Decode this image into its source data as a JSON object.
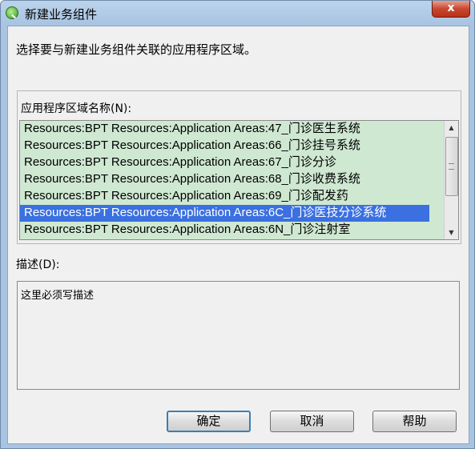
{
  "window": {
    "title": "新建业务组件",
    "close_label": "x"
  },
  "prompt": "选择要与新建业务组件关联的应用程序区域。",
  "list": {
    "label": "应用程序区域名称(N):",
    "items": [
      "Resources:BPT Resources:Application Areas:47_门诊医生系统",
      "Resources:BPT Resources:Application Areas:66_门诊挂号系统",
      "Resources:BPT Resources:Application Areas:67_门诊分诊",
      "Resources:BPT Resources:Application Areas:68_门诊收费系统",
      "Resources:BPT Resources:Application Areas:69_门诊配发药",
      "Resources:BPT Resources:Application Areas:6C_门诊医技分诊系统",
      "Resources:BPT Resources:Application Areas:6N_门诊注射室"
    ],
    "selected_index": 5
  },
  "description": {
    "label": "描述(D):",
    "value": "这里必须写描述"
  },
  "buttons": {
    "ok": "确定",
    "cancel": "取消",
    "help": "帮助"
  },
  "colors": {
    "list_background": "#cfe8d2",
    "selection": "#3a70e0",
    "title_bar": "#a8c4e2"
  }
}
